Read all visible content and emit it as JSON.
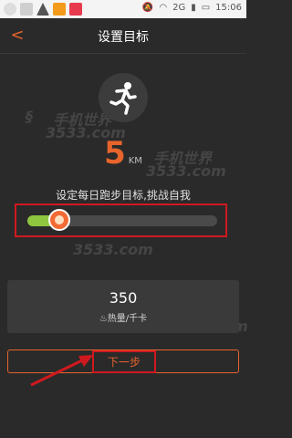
{
  "status": {
    "time": "15:06",
    "network": "2G"
  },
  "header": {
    "title": "设置目标"
  },
  "goal": {
    "distance": "5",
    "unit": "KM",
    "hint": "设定每日跑步目标,挑战自我",
    "slider_level": 0.12
  },
  "calories": {
    "value": "350",
    "label": "热量/千卡"
  },
  "actions": {
    "next_label": "下一步"
  },
  "watermarks": [
    "手机世界",
    "3533.com"
  ],
  "colors": {
    "accent": "#e8642d",
    "annotation": "#d0191f",
    "slider_fill": "#8ec63f",
    "background": "#2a2a2a"
  }
}
